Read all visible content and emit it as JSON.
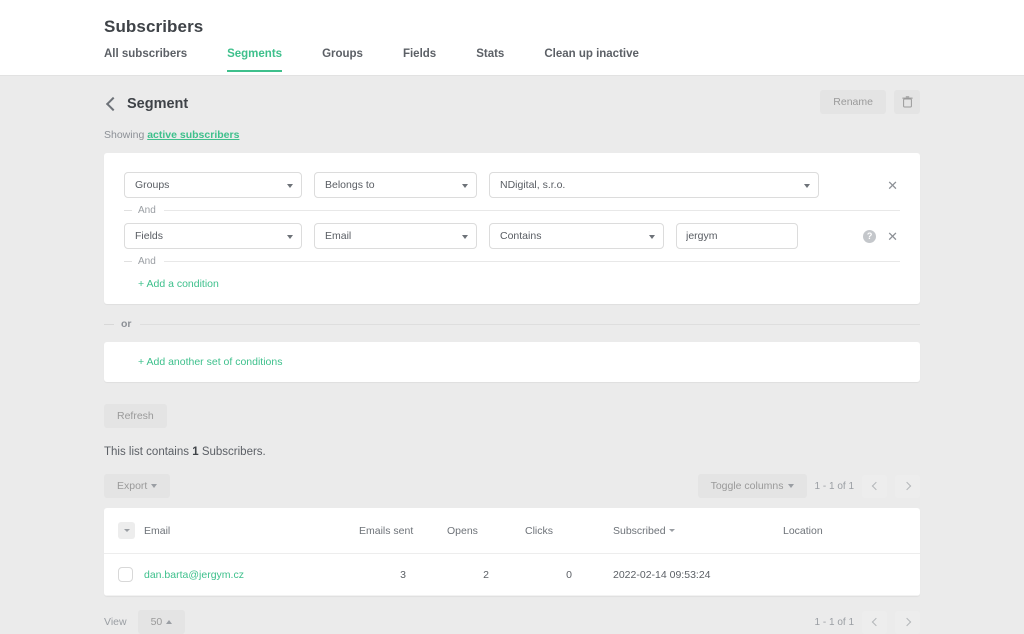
{
  "header": {
    "title": "Subscribers",
    "tabs": [
      {
        "label": "All subscribers",
        "active": false
      },
      {
        "label": "Segments",
        "active": true
      },
      {
        "label": "Groups",
        "active": false
      },
      {
        "label": "Fields",
        "active": false
      },
      {
        "label": "Stats",
        "active": false
      },
      {
        "label": "Clean up inactive",
        "active": false
      }
    ]
  },
  "segment": {
    "title": "Segment",
    "back_icon": "chevron-left-icon",
    "rename_label": "Rename",
    "delete_icon": "trash-icon",
    "showing_prefix": "Showing",
    "showing_link": "active subscribers"
  },
  "conditions": {
    "row1": {
      "type": "Groups",
      "operator": "Belongs to",
      "value": "NDigital, s.r.o.",
      "remove_icon": "close-icon"
    },
    "and_label_1": "And",
    "row2": {
      "type": "Fields",
      "field": "Email",
      "operator": "Contains",
      "value": "jergym",
      "value_placeholder": "",
      "help_icon": "question-icon",
      "remove_icon": "close-icon"
    },
    "and_label_2": "And",
    "add_condition": "+ Add a condition",
    "or_label": "or",
    "add_set": "+ Add another set of conditions"
  },
  "actions": {
    "refresh_label": "Refresh",
    "list_count_prefix": "This list contains",
    "list_count_value": "1",
    "list_count_suffix": "Subscribers.",
    "export_label": "Export",
    "toggle_columns_label": "Toggle columns"
  },
  "pagination": {
    "range": "1 - 1 of 1",
    "prev_icon": "chevron-left-icon",
    "next_icon": "chevron-right-icon"
  },
  "table": {
    "select_all_icon": "select-all-dropdown-icon",
    "columns": [
      "Email",
      "Emails sent",
      "Opens",
      "Clicks",
      "Subscribed",
      "Location"
    ],
    "sorted_column": "Subscribed",
    "rows": [
      {
        "email": "dan.barta@jergym.cz",
        "emails_sent": "3",
        "opens": "2",
        "clicks": "0",
        "subscribed": "2022-02-14 09:53:24",
        "location": ""
      }
    ]
  },
  "footer": {
    "view_label": "View",
    "page_size": "50",
    "range": "1 - 1 of 1"
  },
  "colors": {
    "accent_green": "#3ec08c",
    "page_bg": "#ebebeb",
    "card_bg": "#ffffff",
    "button_grey": "#e4e4e4",
    "text_dark": "#3f4348",
    "text_muted": "#8c9096"
  }
}
